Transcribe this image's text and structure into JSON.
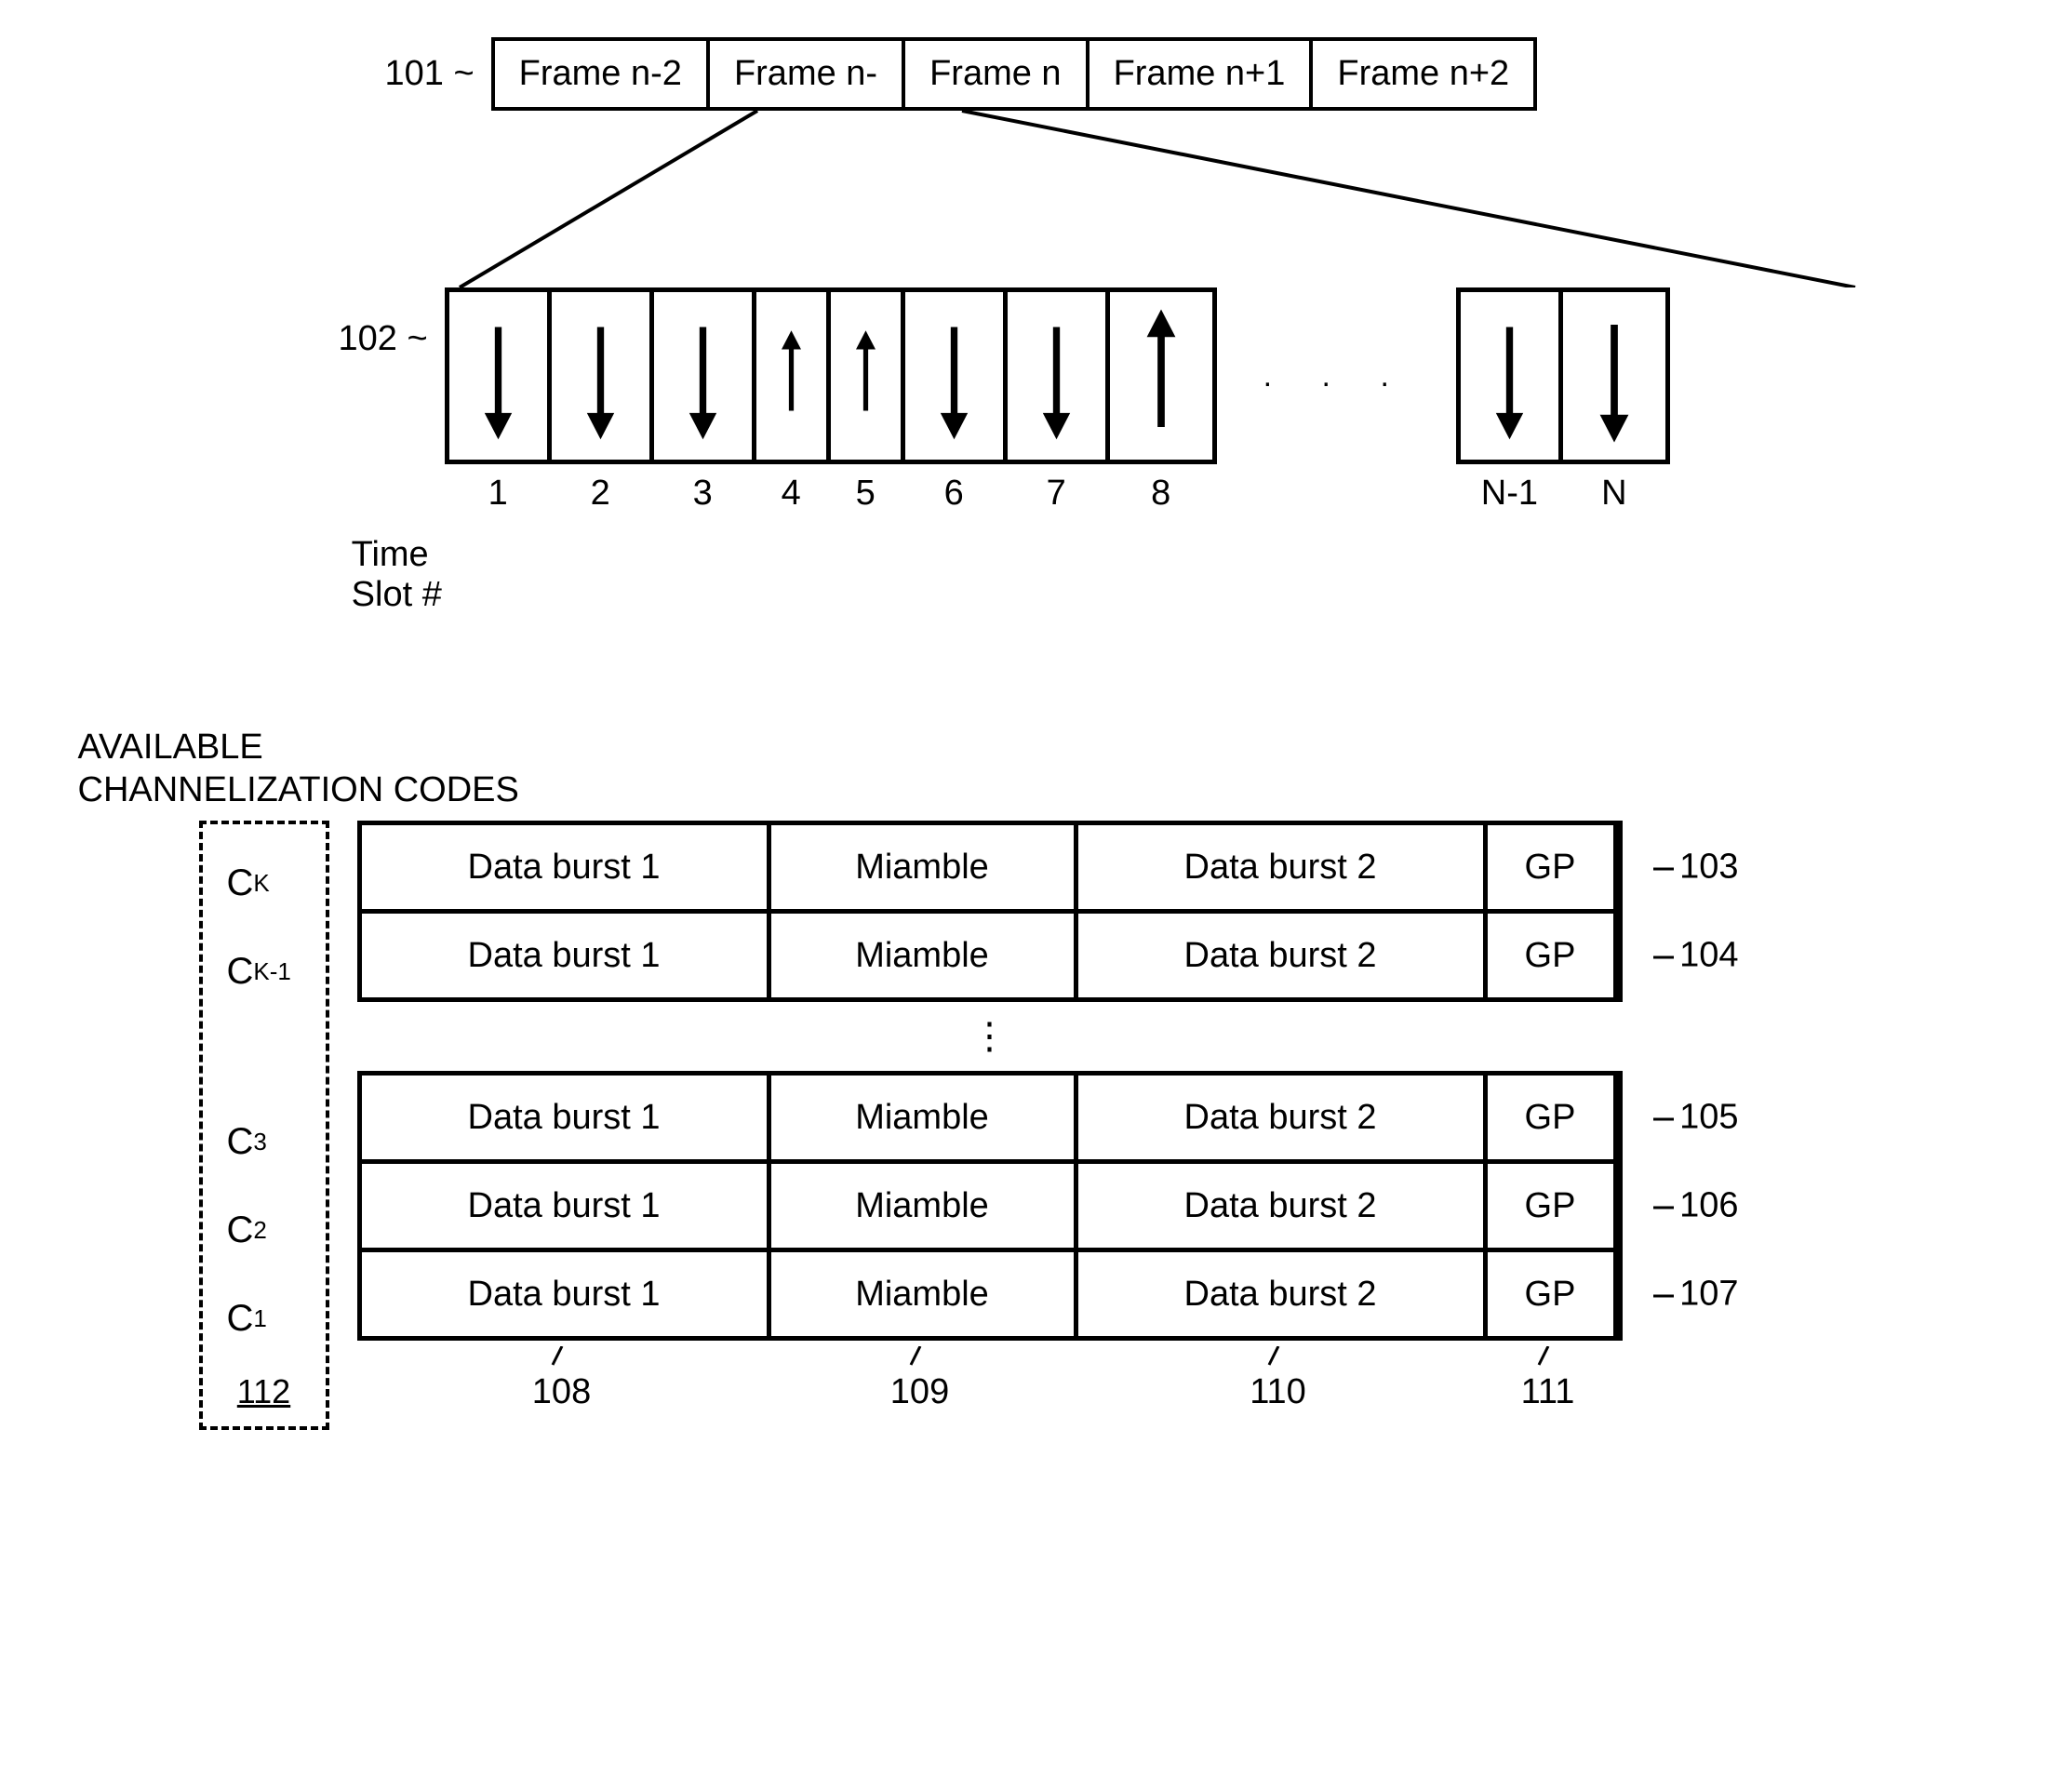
{
  "refs": {
    "frames": "101",
    "slots": "102",
    "row_k": "103",
    "row_k1": "104",
    "row_3": "105",
    "row_2": "106",
    "row_1": "107",
    "col_data1": "108",
    "col_mid": "109",
    "col_data2": "110",
    "col_gp": "111",
    "codes": "112"
  },
  "frames": {
    "items": [
      "Frame n-2",
      "Frame n-",
      "Frame n",
      "Frame n+1",
      "Frame n+2"
    ]
  },
  "slots": {
    "label1": "Time",
    "label2": "Slot #",
    "main": [
      {
        "num": "1",
        "dir": "down"
      },
      {
        "num": "2",
        "dir": "down"
      },
      {
        "num": "3",
        "dir": "down"
      },
      {
        "num": "4",
        "dir": "up"
      },
      {
        "num": "5",
        "dir": "up"
      },
      {
        "num": "6",
        "dir": "down"
      },
      {
        "num": "7",
        "dir": "down"
      },
      {
        "num": "8",
        "dir": "up"
      }
    ],
    "tail": [
      {
        "num": "N-1",
        "dir": "down"
      },
      {
        "num": "N",
        "dir": "down"
      }
    ],
    "dots": ".   .   ."
  },
  "codes": {
    "title1": "AVAILABLE",
    "title2": "CHANNELIZATION CODES",
    "items_top": [
      "K",
      "K-1"
    ],
    "items_bot": [
      "3",
      "2",
      "1"
    ],
    "prefix": "C"
  },
  "burst": {
    "data1": "Data burst 1",
    "mid": "Miamble",
    "data2": "Data burst 2",
    "gp": "GP",
    "vdots": "⋮"
  }
}
